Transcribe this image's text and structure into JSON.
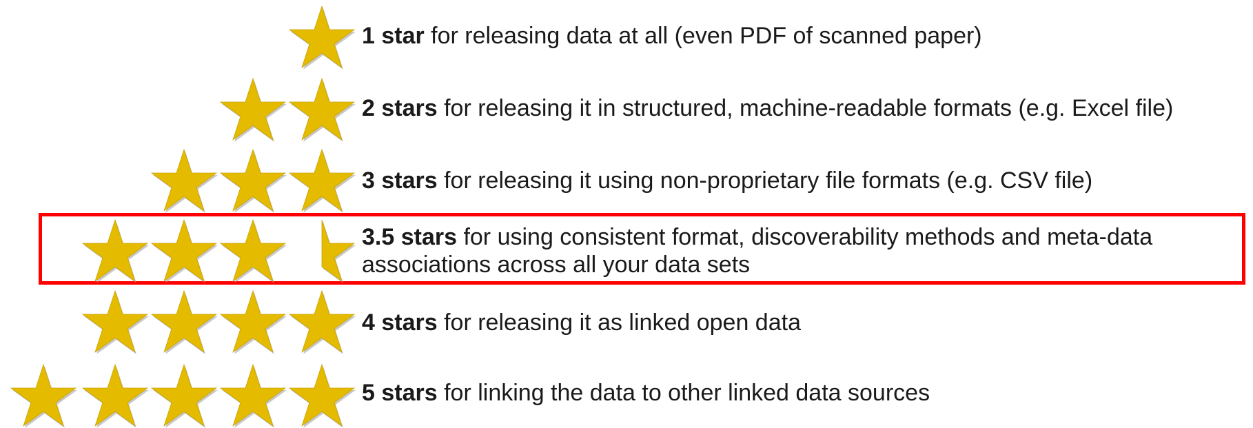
{
  "colors": {
    "star_fill": "#e5bb00",
    "star_shadow": "#9a9a9a",
    "highlight_border": "#ff0000",
    "text": "#1a1a1a"
  },
  "levels": [
    {
      "stars": 1,
      "bold": "1 star",
      "text": " for releasing data at all (even PDF of scanned paper)"
    },
    {
      "stars": 2,
      "bold": "2 stars",
      "text": " for releasing it in structured, machine-readable formats (e.g. Excel file)"
    },
    {
      "stars": 3,
      "bold": "3 stars",
      "text": " for releasing it using non-proprietary file formats (e.g. CSV file)"
    },
    {
      "stars": 3.5,
      "bold": "3.5 stars",
      "text": " for using consistent format, discoverability methods and meta-data",
      "text_line2": "associations across all your data sets",
      "highlighted": true
    },
    {
      "stars": 4,
      "bold": "4 stars",
      "text": " for releasing it as linked open data"
    },
    {
      "stars": 5,
      "bold": "5 stars",
      "text": " for linking the data to other linked data sources"
    }
  ]
}
